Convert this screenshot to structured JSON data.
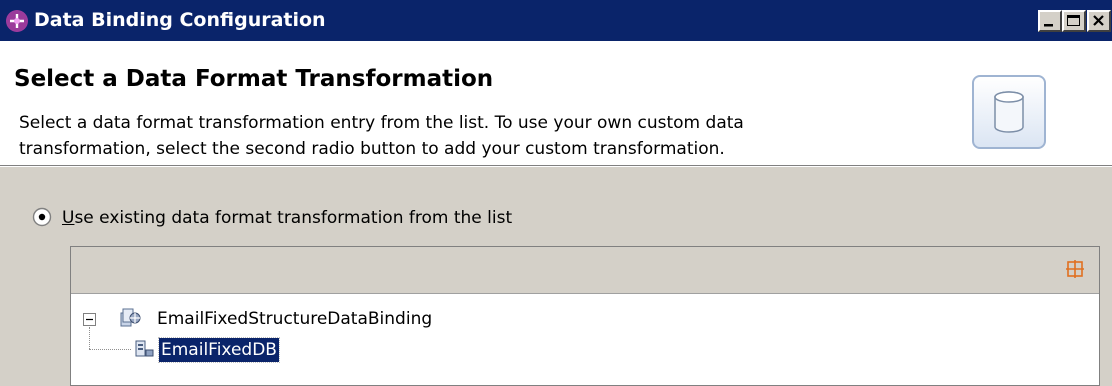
{
  "window": {
    "title": "Data Binding Configuration",
    "icon": "data-binding-icon",
    "controls": [
      "minimize-icon",
      "maximize-icon",
      "close-icon"
    ]
  },
  "header": {
    "title": "Select a Data Format Transformation",
    "description_line1": "Select a data format transformation entry from the list.  To use your own custom data",
    "description_line2": "transformation, select the second radio button to add your custom transformation.",
    "banner_icon": "cylinder-icon"
  },
  "options": {
    "existing": {
      "mnemonic": "U",
      "label_rest": "se existing data format transformation from the list",
      "selected": true
    }
  },
  "list": {
    "toolbar_icon": "grid-icon",
    "tree": [
      {
        "label": "EmailFixedStructureDataBinding",
        "icon": "databinding-module-icon",
        "expanded": true,
        "children": [
          {
            "label": "EmailFixedDB",
            "icon": "databinding-entry-icon",
            "selected": true
          }
        ]
      }
    ]
  },
  "colors": {
    "titlebar": "#0a246a",
    "dialog_bg": "#d4d0c8",
    "selection": "#0a246a",
    "accent_icon": "#e07020"
  }
}
